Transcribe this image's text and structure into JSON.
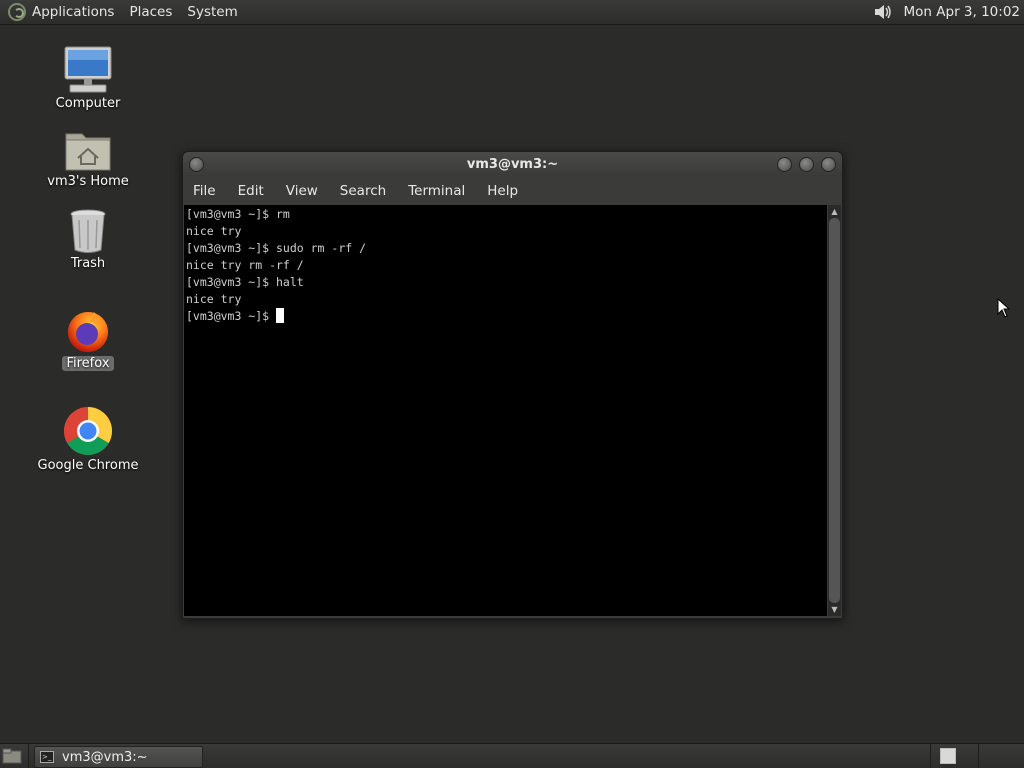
{
  "top_panel": {
    "menus": [
      "Applications",
      "Places",
      "System"
    ],
    "clock": "Mon Apr  3, 10:02"
  },
  "desktop_icons": {
    "computer": "Computer",
    "home": "vm3's Home",
    "trash": "Trash",
    "firefox": "Firefox",
    "chrome": "Google Chrome"
  },
  "window": {
    "title": "vm3@vm3:~",
    "menus": [
      "File",
      "Edit",
      "View",
      "Search",
      "Terminal",
      "Help"
    ]
  },
  "terminal": {
    "lines": [
      "[vm3@vm3 ~]$ rm",
      "nice try",
      "[vm3@vm3 ~]$ sudo rm -rf /",
      "nice try rm -rf /",
      "[vm3@vm3 ~]$ halt",
      "nice try",
      "[vm3@vm3 ~]$ "
    ]
  },
  "taskbar": {
    "task_label": "vm3@vm3:~"
  }
}
